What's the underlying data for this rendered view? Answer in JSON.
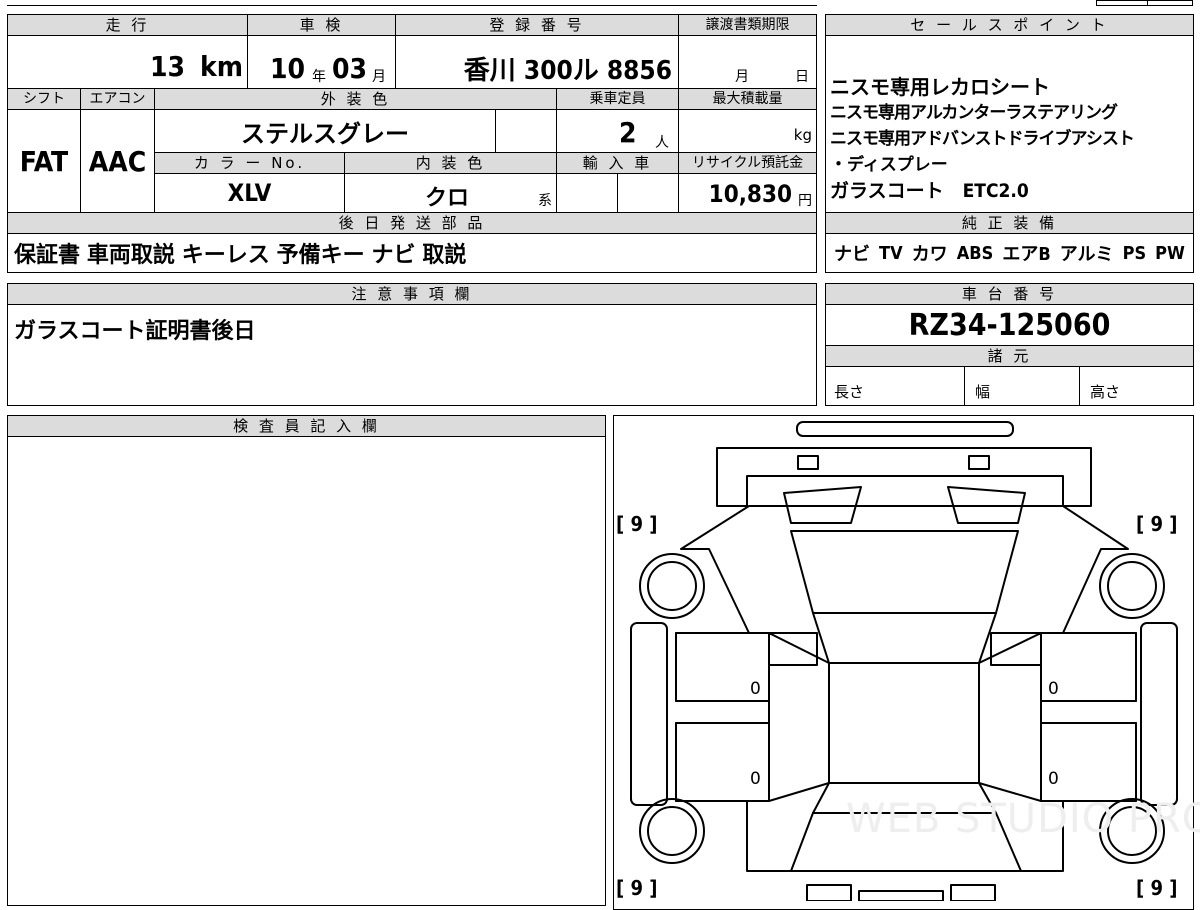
{
  "top": {
    "mileage_header": "走 行",
    "mileage_value": "13",
    "mileage_unit": "km",
    "inspection_header": "車 検",
    "inspection_year": "10",
    "inspection_year_unit": "年",
    "inspection_month": "03",
    "inspection_month_unit": "月",
    "plate_header": "登 録 番 号",
    "plate_value": "香川 300ル 8856",
    "transfer_header": "譲渡書類期限",
    "transfer_month_unit": "月",
    "transfer_day_unit": "日"
  },
  "row2": {
    "shift_header": "シフト",
    "shift_value": "FAT",
    "ac_header": "エアコン",
    "ac_value": "AAC",
    "exterior_header": "外 装 色",
    "exterior_value": "ステルスグレー",
    "capacity_header": "乗車定員",
    "capacity_value": "2",
    "capacity_unit": "人",
    "maxload_header": "最大積載量",
    "maxload_unit": "kg",
    "colorno_header": "カ ラ ー No.",
    "colorno_value": "XLV",
    "interior_header": "内 装 色",
    "interior_value": "クロ",
    "interior_unit": "系",
    "import_header": "輸 入 車",
    "recycle_header": "リサイクル預託金",
    "recycle_value": "10,830",
    "recycle_unit": "円"
  },
  "later_parts": {
    "header": "後 日 発 送 部 品",
    "value": "保証書 車両取説 キーレス 予備キー ナビ 取説"
  },
  "sales_point": {
    "header": "セ ー ル ス ポ イ ン ト",
    "lines": [
      "ニスモ専用レカロシート",
      "ニスモ専用アルカンターラステアリング",
      "ニスモ専用アドバンストドライブアシスト",
      "・ディスプレー",
      "ガラスコート　ETC2.0"
    ]
  },
  "equipment": {
    "header": "純 正 装 備",
    "items": [
      "ナビ",
      "TV",
      "カワ",
      "ABS",
      "エアB",
      "アルミ",
      "PS",
      "PW"
    ]
  },
  "notes": {
    "header": "注 意 事 項 欄",
    "value": "ガラスコート証明書後日"
  },
  "chassis": {
    "header": "車 台 番 号",
    "value": "RZ34-125060"
  },
  "specs": {
    "header": "諸 元",
    "length_label": "長さ",
    "width_label": "幅",
    "height_label": "高さ"
  },
  "inspector": {
    "header": "検 査 員 記 入 欄"
  },
  "diagram": {
    "tire_front_left": "[ 9 ]",
    "tire_front_right": "[ 9 ]",
    "tire_rear_left": "[ 9 ]",
    "tire_rear_right": "[ 9 ]",
    "door_marks": [
      "0",
      "0",
      "0",
      "0"
    ],
    "watermark": "WEB STUDIO PRO"
  }
}
